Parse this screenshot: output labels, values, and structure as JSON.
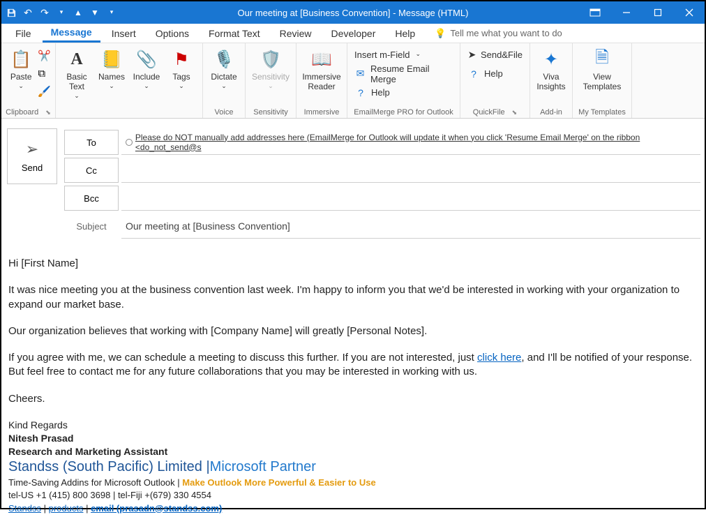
{
  "titlebar": {
    "title": "Our meeting at [Business Convention]  -  Message (HTML)"
  },
  "menus": {
    "file": "File",
    "message": "Message",
    "insert": "Insert",
    "options": "Options",
    "format": "Format Text",
    "review": "Review",
    "developer": "Developer",
    "help": "Help",
    "tellme": "Tell me what you want to do"
  },
  "ribbon": {
    "clipboard": {
      "paste": "Paste",
      "group": "Clipboard"
    },
    "basic": {
      "basictext": "Basic Text",
      "names": "Names",
      "include": "Include",
      "tags": "Tags"
    },
    "voice": {
      "dictate": "Dictate",
      "group": "Voice"
    },
    "sensitivity": {
      "btn": "Sensitivity",
      "group": "Sensitivity"
    },
    "immersive": {
      "btn": "Immersive Reader",
      "group": "Immersive"
    },
    "emailmerge": {
      "insertm": "Insert m-Field",
      "resume": "Resume Email Merge",
      "help": "Help",
      "group": "EmailMerge PRO for Outlook"
    },
    "quickfile": {
      "sendfile": "Send&File",
      "help": "Help",
      "group": "QuickFile"
    },
    "addin": {
      "viva": "Viva Insights",
      "group": "Add-in"
    },
    "templates": {
      "view": "View Templates",
      "group": "My Templates"
    }
  },
  "compose": {
    "send": "Send",
    "to": "To",
    "cc": "Cc",
    "bcc": "Bcc",
    "toval": "Please do NOT manually add addresses here (EmailMerge for Outlook will update it when you click 'Resume Email Merge' on the ribbon <do_not_send@s",
    "subjectlabel": "Subject",
    "subject": "Our meeting at [Business Convention]"
  },
  "body": {
    "greet": "Hi [First Name]",
    "p1": "It was nice meeting you at the business convention last week. I'm happy to inform you that we'd be interested in working with your organization to expand our market base.",
    "p2": "Our organization believes that working with [Company Name] will greatly [Personal Notes].",
    "p3a": "If you agree with me, we can schedule a meeting to discuss this further. If you are not interested, just ",
    "p3link": "click here",
    "p3b": ", and I'll be notified of your response. But feel free to contact me for any future collaborations that you may be interested in working with us.",
    "p4": "Cheers."
  },
  "sig": {
    "regards": "Kind Regards",
    "name": "Nitesh Prasad",
    "role": "Research and Marketing Assistant",
    "company": "Standss (South Pacific) Limited ",
    "sep": "|",
    "partner": "Microsoft Partner",
    "tag1": "Time-Saving Addins for Microsoft Outlook | ",
    "tag2": "Make Outlook More Powerful & Easier to Use",
    "tels": "tel-US +1 (415) 800 3698  |    tel-Fiji +(679) 330 4554",
    "l1": "Standss",
    "lsep": " | ",
    "l2": " products",
    "l3": "email (prasadn@standss.com)"
  }
}
